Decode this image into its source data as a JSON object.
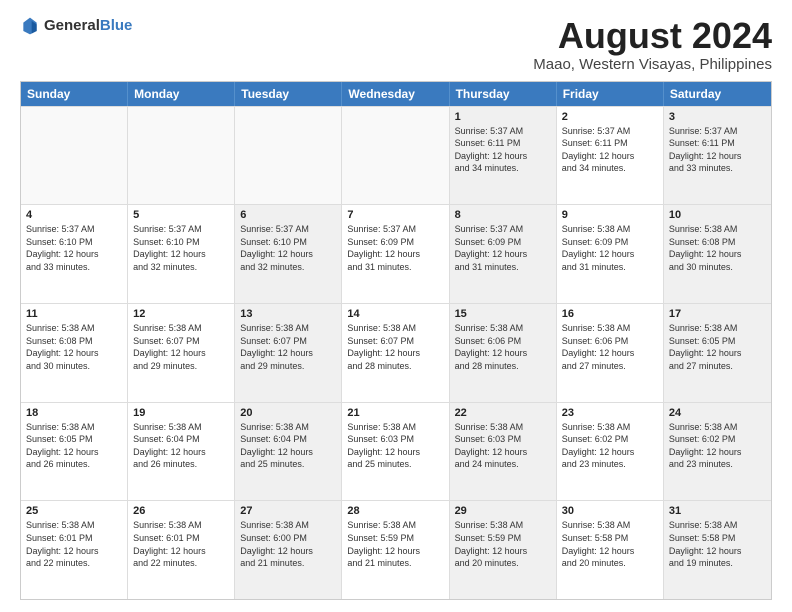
{
  "logo": {
    "general": "General",
    "blue": "Blue"
  },
  "title": "August 2024",
  "subtitle": "Maao, Western Visayas, Philippines",
  "days": [
    "Sunday",
    "Monday",
    "Tuesday",
    "Wednesday",
    "Thursday",
    "Friday",
    "Saturday"
  ],
  "weeks": [
    [
      {
        "day": "",
        "content": ""
      },
      {
        "day": "",
        "content": ""
      },
      {
        "day": "",
        "content": ""
      },
      {
        "day": "",
        "content": ""
      },
      {
        "day": "1",
        "content": "Sunrise: 5:37 AM\nSunset: 6:11 PM\nDaylight: 12 hours\nand 34 minutes."
      },
      {
        "day": "2",
        "content": "Sunrise: 5:37 AM\nSunset: 6:11 PM\nDaylight: 12 hours\nand 34 minutes."
      },
      {
        "day": "3",
        "content": "Sunrise: 5:37 AM\nSunset: 6:11 PM\nDaylight: 12 hours\nand 33 minutes."
      }
    ],
    [
      {
        "day": "4",
        "content": "Sunrise: 5:37 AM\nSunset: 6:10 PM\nDaylight: 12 hours\nand 33 minutes."
      },
      {
        "day": "5",
        "content": "Sunrise: 5:37 AM\nSunset: 6:10 PM\nDaylight: 12 hours\nand 32 minutes."
      },
      {
        "day": "6",
        "content": "Sunrise: 5:37 AM\nSunset: 6:10 PM\nDaylight: 12 hours\nand 32 minutes."
      },
      {
        "day": "7",
        "content": "Sunrise: 5:37 AM\nSunset: 6:09 PM\nDaylight: 12 hours\nand 31 minutes."
      },
      {
        "day": "8",
        "content": "Sunrise: 5:37 AM\nSunset: 6:09 PM\nDaylight: 12 hours\nand 31 minutes."
      },
      {
        "day": "9",
        "content": "Sunrise: 5:38 AM\nSunset: 6:09 PM\nDaylight: 12 hours\nand 31 minutes."
      },
      {
        "day": "10",
        "content": "Sunrise: 5:38 AM\nSunset: 6:08 PM\nDaylight: 12 hours\nand 30 minutes."
      }
    ],
    [
      {
        "day": "11",
        "content": "Sunrise: 5:38 AM\nSunset: 6:08 PM\nDaylight: 12 hours\nand 30 minutes."
      },
      {
        "day": "12",
        "content": "Sunrise: 5:38 AM\nSunset: 6:07 PM\nDaylight: 12 hours\nand 29 minutes."
      },
      {
        "day": "13",
        "content": "Sunrise: 5:38 AM\nSunset: 6:07 PM\nDaylight: 12 hours\nand 29 minutes."
      },
      {
        "day": "14",
        "content": "Sunrise: 5:38 AM\nSunset: 6:07 PM\nDaylight: 12 hours\nand 28 minutes."
      },
      {
        "day": "15",
        "content": "Sunrise: 5:38 AM\nSunset: 6:06 PM\nDaylight: 12 hours\nand 28 minutes."
      },
      {
        "day": "16",
        "content": "Sunrise: 5:38 AM\nSunset: 6:06 PM\nDaylight: 12 hours\nand 27 minutes."
      },
      {
        "day": "17",
        "content": "Sunrise: 5:38 AM\nSunset: 6:05 PM\nDaylight: 12 hours\nand 27 minutes."
      }
    ],
    [
      {
        "day": "18",
        "content": "Sunrise: 5:38 AM\nSunset: 6:05 PM\nDaylight: 12 hours\nand 26 minutes."
      },
      {
        "day": "19",
        "content": "Sunrise: 5:38 AM\nSunset: 6:04 PM\nDaylight: 12 hours\nand 26 minutes."
      },
      {
        "day": "20",
        "content": "Sunrise: 5:38 AM\nSunset: 6:04 PM\nDaylight: 12 hours\nand 25 minutes."
      },
      {
        "day": "21",
        "content": "Sunrise: 5:38 AM\nSunset: 6:03 PM\nDaylight: 12 hours\nand 25 minutes."
      },
      {
        "day": "22",
        "content": "Sunrise: 5:38 AM\nSunset: 6:03 PM\nDaylight: 12 hours\nand 24 minutes."
      },
      {
        "day": "23",
        "content": "Sunrise: 5:38 AM\nSunset: 6:02 PM\nDaylight: 12 hours\nand 23 minutes."
      },
      {
        "day": "24",
        "content": "Sunrise: 5:38 AM\nSunset: 6:02 PM\nDaylight: 12 hours\nand 23 minutes."
      }
    ],
    [
      {
        "day": "25",
        "content": "Sunrise: 5:38 AM\nSunset: 6:01 PM\nDaylight: 12 hours\nand 22 minutes."
      },
      {
        "day": "26",
        "content": "Sunrise: 5:38 AM\nSunset: 6:01 PM\nDaylight: 12 hours\nand 22 minutes."
      },
      {
        "day": "27",
        "content": "Sunrise: 5:38 AM\nSunset: 6:00 PM\nDaylight: 12 hours\nand 21 minutes."
      },
      {
        "day": "28",
        "content": "Sunrise: 5:38 AM\nSunset: 5:59 PM\nDaylight: 12 hours\nand 21 minutes."
      },
      {
        "day": "29",
        "content": "Sunrise: 5:38 AM\nSunset: 5:59 PM\nDaylight: 12 hours\nand 20 minutes."
      },
      {
        "day": "30",
        "content": "Sunrise: 5:38 AM\nSunset: 5:58 PM\nDaylight: 12 hours\nand 20 minutes."
      },
      {
        "day": "31",
        "content": "Sunrise: 5:38 AM\nSunset: 5:58 PM\nDaylight: 12 hours\nand 19 minutes."
      }
    ]
  ]
}
